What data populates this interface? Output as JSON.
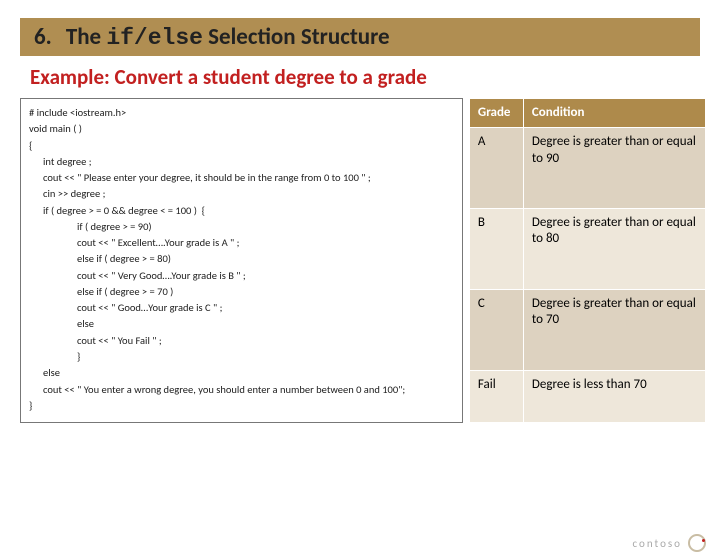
{
  "title": {
    "number": "6.",
    "pre": "The ",
    "mono": "if/else",
    "post": " Selection Structure"
  },
  "subtitle": "Example: Convert a student degree to a grade",
  "code": {
    "l0": "# include <iostream.h>",
    "l1": "void main ( )",
    "l2": "{",
    "l3": "int degree ;",
    "l4": "cout << \" Please enter your degree, it should be in the range from 0 to 100 \" ;",
    "l5": "cin >> degree ;",
    "l6": "if ( degree > = 0 && degree < = 100 )  {",
    "l7": "if ( degree > = 90)",
    "l8": "cout << \" Excellent….Your grade is A \" ;",
    "l9": "else if ( degree > = 80)",
    "l10": "cout << \" Very Good….Your grade is B \" ;",
    "l11": "else if ( degree > = 70 )",
    "l12": "cout << \" Good…Your grade is C \" ;",
    "l13": "else",
    "l14": "cout << \" You Fail \" ;",
    "l15": "}",
    "l16": "else",
    "l17": "cout << \" You enter a wrong degree, you should enter a number between 0 and 100\";",
    "l18": "}"
  },
  "table": {
    "headers": {
      "grade": "Grade",
      "condition": "Condition"
    },
    "rows": [
      {
        "grade": "A",
        "condition": "Degree is greater than or equal to  90"
      },
      {
        "grade": "B",
        "condition": "Degree is greater than or equal to  80"
      },
      {
        "grade": "C",
        "condition": "Degree is greater than or equal to  70"
      },
      {
        "grade": "Fail",
        "condition": "Degree is less than 70"
      }
    ]
  },
  "footer": {
    "brand": "contoso"
  }
}
